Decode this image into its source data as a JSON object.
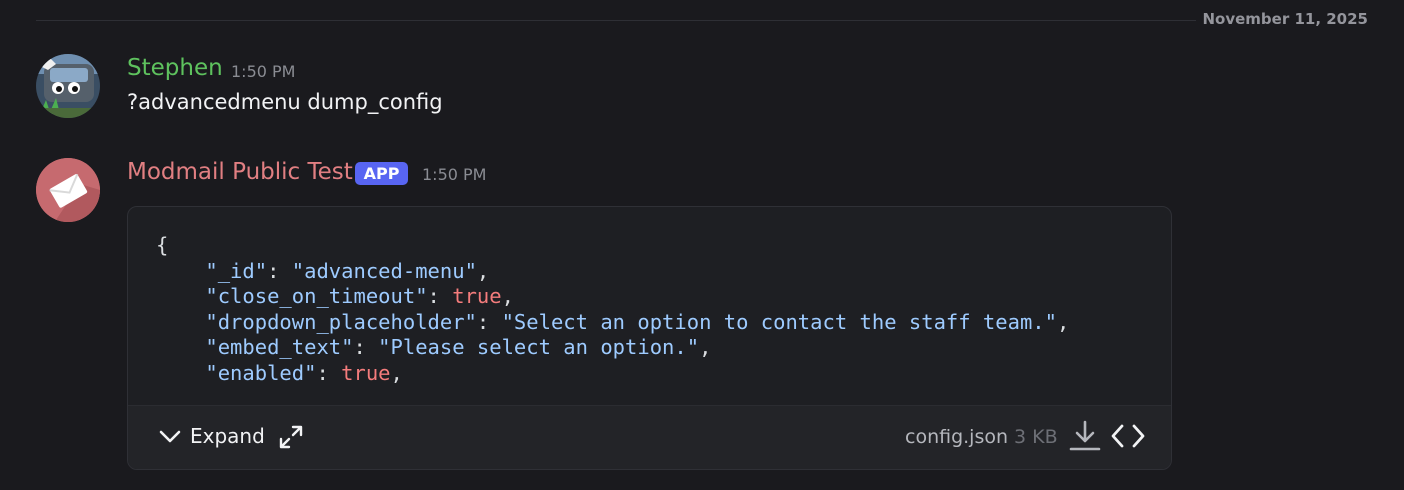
{
  "date_divider": "November 11, 2025",
  "messages": [
    {
      "author": "Stephen",
      "timestamp": "1:50 PM",
      "text": "?advancedmenu dump_config"
    },
    {
      "author": "Modmail Public Test",
      "badge": "APP",
      "timestamp": "1:50 PM"
    }
  ],
  "attachment": {
    "code_lines": [
      {
        "open": "{"
      },
      {
        "key": "\"_id\"",
        "value": "\"advanced-menu\"",
        "value_type": "string"
      },
      {
        "key": "\"close_on_timeout\"",
        "value": "true",
        "value_type": "bool"
      },
      {
        "key": "\"dropdown_placeholder\"",
        "value": "\"Select an option to contact the staff team.\"",
        "value_type": "string"
      },
      {
        "key": "\"embed_text\"",
        "value": "\"Please select an option.\"",
        "value_type": "string"
      },
      {
        "key": "\"enabled\"",
        "value": "true",
        "value_type": "bool"
      }
    ],
    "expand_label": "Expand",
    "filename": "config.json",
    "filesize": "3 KB",
    "icons": [
      "chevron-down-icon",
      "fullscreen-icon",
      "download-icon",
      "code-icon"
    ]
  },
  "colors": {
    "background": "#1a1a1e",
    "stephen_name": "#5ec25e",
    "modmail_name": "#e17f82",
    "app_badge": "#5865f2",
    "json_string": "#9ecbff",
    "json_bool": "#f47c7c"
  }
}
